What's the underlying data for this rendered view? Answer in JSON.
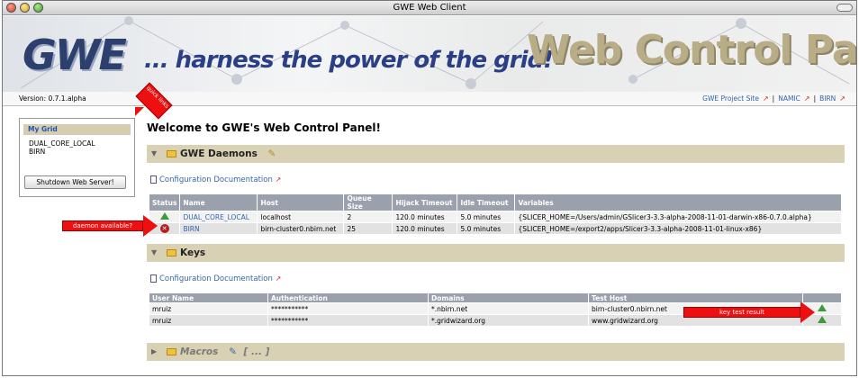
{
  "window": {
    "title": "GWE Web Client"
  },
  "banner": {
    "logo": "GWE",
    "tagline": "... harness the power of the grid!",
    "title": "Web Control Panel"
  },
  "versionbar": {
    "version": "Version: 0.7.1.alpha",
    "links": [
      "GWE Project Site",
      "NAMIC",
      "BIRN"
    ],
    "separator": "|"
  },
  "sidebar": {
    "heading": "My Grid",
    "items": [
      "DUAL_CORE_LOCAL",
      "BIRN"
    ],
    "shutdown_label": "Shutdown Web Server!"
  },
  "main": {
    "welcome": "Welcome to GWE's Web Control Panel!",
    "daemons": {
      "heading": "GWE Daemons",
      "doc_link": "Configuration Documentation",
      "columns": [
        "Status",
        "Name",
        "Host",
        "Queue Size",
        "Hijack Timeout",
        "Idle Timeout",
        "Variables"
      ],
      "rows": [
        {
          "status": "ok",
          "name": "DUAL_CORE_LOCAL",
          "host": "localhost",
          "queue": "2",
          "hijack": "120.0 minutes",
          "idle": "5.0 minutes",
          "vars": "{SLICER_HOME=/Users/admin/GSlicer3-3.3-alpha-2008-11-01-darwin-x86-0.7.0.alpha}"
        },
        {
          "status": "error",
          "name": "BIRN",
          "host": "birn-cluster0.nbirn.net",
          "queue": "25",
          "hijack": "120.0 minutes",
          "idle": "5.0 minutes",
          "vars": "{SLICER_HOME=/export2/apps/Slicer3-3.3-alpha-2008-11-01-linux-x86}"
        }
      ]
    },
    "keys": {
      "heading": "Keys",
      "doc_link": "Configuration Documentation",
      "columns": [
        "User Name",
        "Authentication",
        "Domains",
        "Test Host",
        ""
      ],
      "rows": [
        {
          "user": "mruiz",
          "auth": "***********",
          "domains": "*.nbirn.net",
          "host": "birn-cluster0.nbirn.net"
        },
        {
          "user": "mruiz",
          "auth": "***********",
          "domains": "*.gridwizard.org",
          "host": "www.gridwizard.org"
        }
      ]
    },
    "macros": {
      "heading": "Macros",
      "extra": "[ ... ]"
    }
  },
  "callouts": {
    "quick_links": "quick links",
    "daemon_available": "daemon available?",
    "key_test": "key test result"
  },
  "colors": {
    "section_bg": "#d9d1b4",
    "header_bg": "#9aa0ac",
    "callout": "#ee1010",
    "link": "#3366aa"
  }
}
